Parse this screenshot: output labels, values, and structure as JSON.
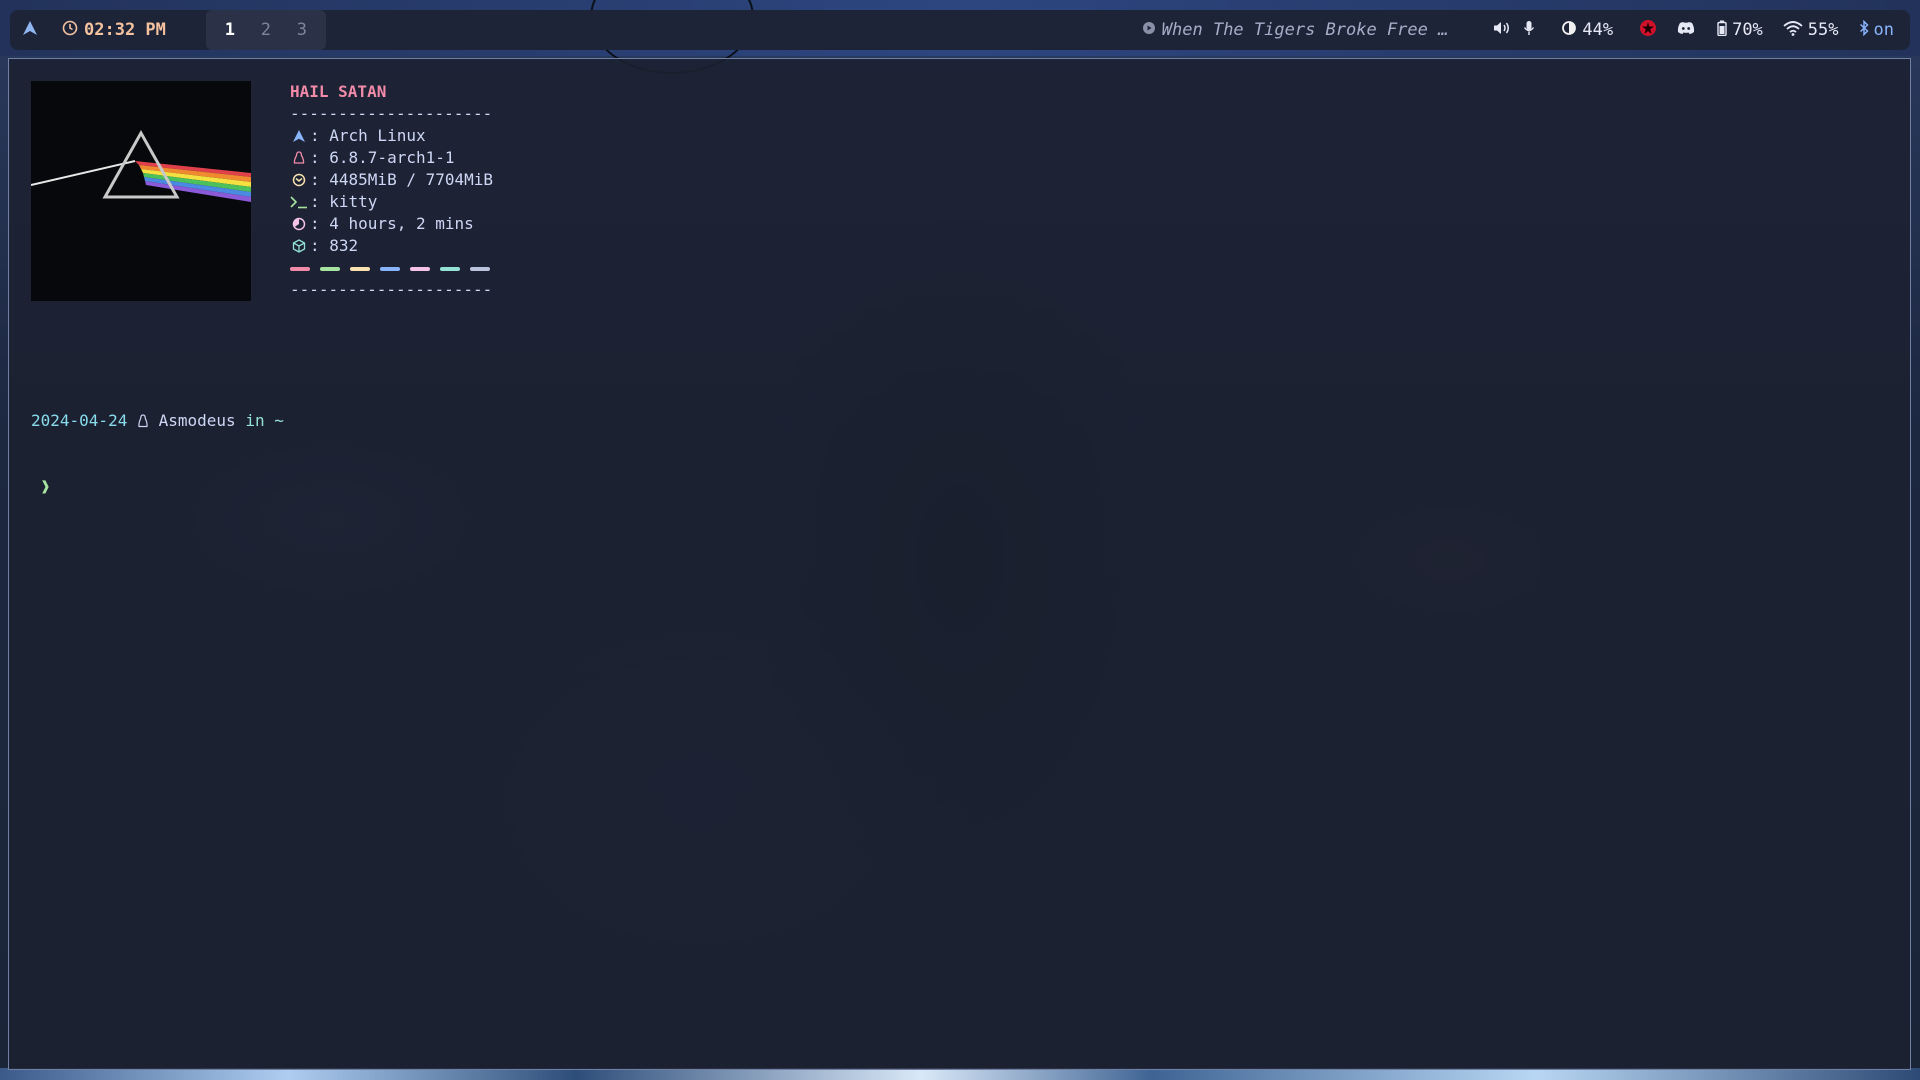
{
  "bar": {
    "clock": "02:32 PM",
    "workspaces": [
      "1",
      "2",
      "3"
    ],
    "active_workspace": "1",
    "media_title": "When The Tigers Broke Free …",
    "brightness": "44%",
    "battery": "70%",
    "wifi": "55%",
    "bluetooth": "on",
    "colors": {
      "bar_bg": "#1e2438",
      "clock": "#f5c2a0",
      "accent": "#89b4fa"
    },
    "icons": [
      "arch-logo-icon",
      "clock-icon",
      "music-icon",
      "volume-icon",
      "microphone-icon",
      "brightness-icon",
      "record-icon",
      "discord-icon",
      "battery-icon",
      "wifi-icon",
      "bluetooth-icon"
    ]
  },
  "terminal": {
    "fetch": {
      "title": "HAIL SATAN",
      "separator": "---------------------",
      "rows": [
        {
          "icon": "arch-logo-icon",
          "value": ": Arch Linux",
          "color": "#89b4fa"
        },
        {
          "icon": "linux-tux-icon",
          "value": ": 6.8.7-arch1-1",
          "color": "#f38ba8"
        },
        {
          "icon": "memory-icon",
          "value": ": 4485MiB / 7704MiB",
          "color": "#f9e2af"
        },
        {
          "icon": "terminal-icon",
          "value": ": kitty",
          "color": "#a6e3a1"
        },
        {
          "icon": "uptime-icon",
          "value": ": 4 hours, 2 mins",
          "color": "#f5c2e7"
        },
        {
          "icon": "package-icon",
          "value": ": 832",
          "color": "#94e2d5"
        }
      ],
      "swatch_colors": [
        "#f38ba8",
        "#a6e3a1",
        "#f9e2af",
        "#89b4fa",
        "#f5c2e7",
        "#94e2d5",
        "#bac2de"
      ]
    },
    "prompt": {
      "date": "2024-04-24",
      "user": "Asmodeus",
      "in": "in",
      "dir": "~",
      "arrow": "❱"
    }
  }
}
